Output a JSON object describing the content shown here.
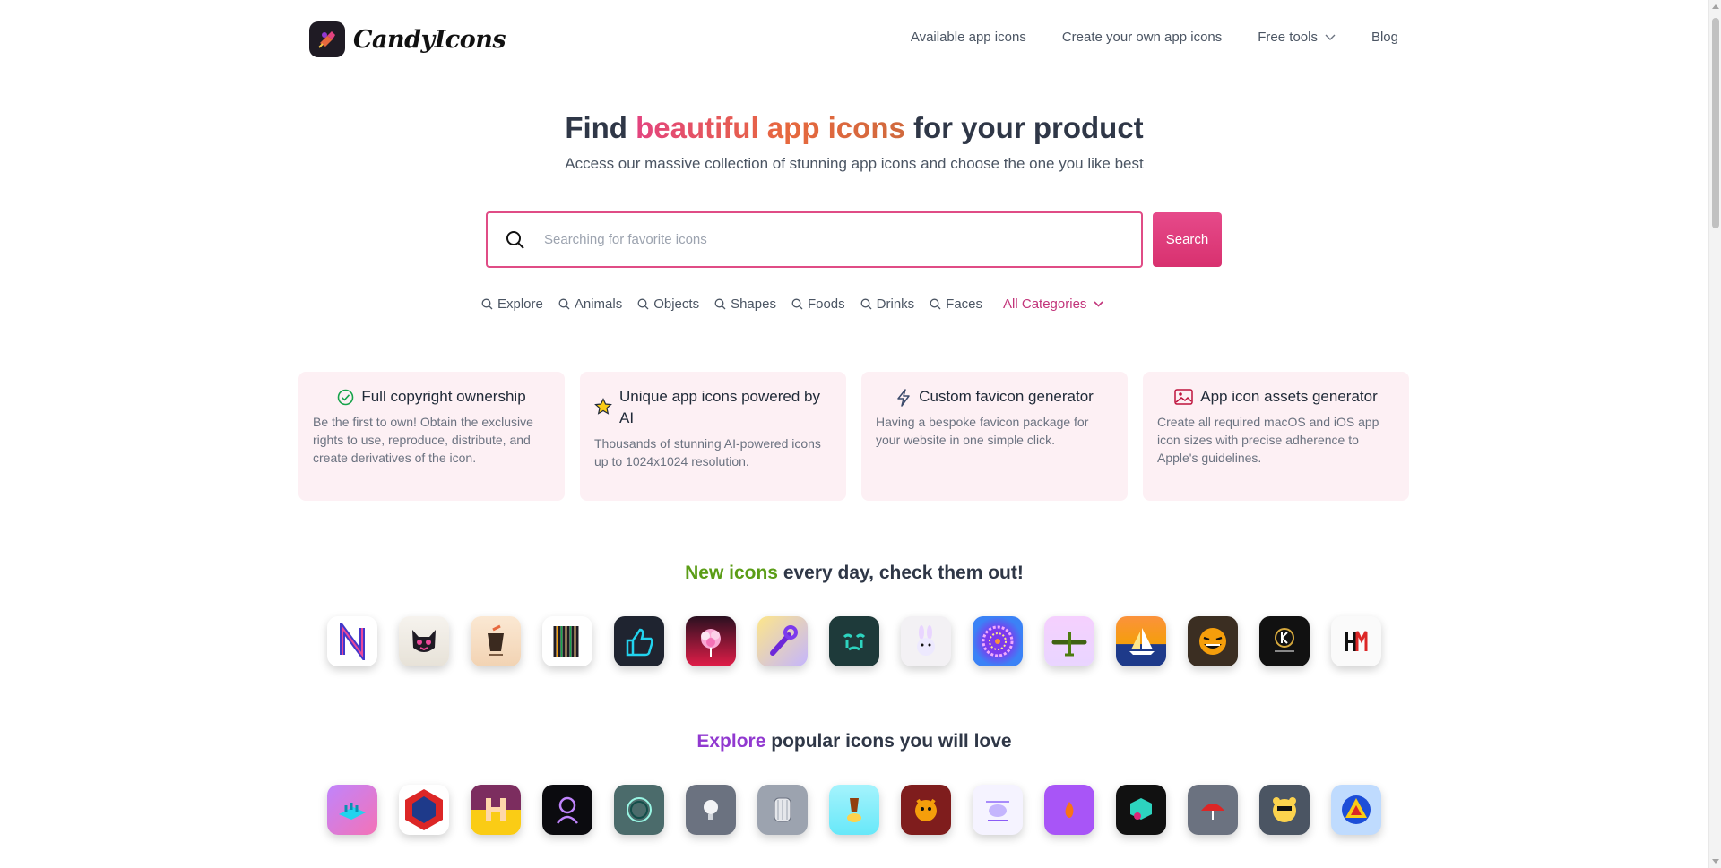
{
  "brand": {
    "name": "CandyIcons"
  },
  "nav": {
    "available": "Available app icons",
    "create": "Create your own app icons",
    "free_tools": "Free tools",
    "blog": "Blog"
  },
  "hero": {
    "title_pre": "Find ",
    "title_highlight": "beautiful app icons",
    "title_post": " for your product",
    "subtitle": "Access our massive collection of stunning app icons and choose the one you like best"
  },
  "search": {
    "placeholder": "Searching for favorite icons",
    "button": "Search"
  },
  "categories": {
    "items": [
      "Explore",
      "Animals",
      "Objects",
      "Shapes",
      "Foods",
      "Drinks",
      "Faces"
    ],
    "all": "All Categories"
  },
  "features": [
    {
      "icon": "check-circle-icon",
      "title": "Full copyright ownership",
      "body": "Be the first to own! Obtain the exclusive rights to use, reproduce, distribute, and create derivatives of the icon."
    },
    {
      "icon": "star-icon",
      "title": "Unique app icons powered by AI",
      "body": "Thousands of stunning AI-powered icons up to 1024x1024 resolution."
    },
    {
      "icon": "lightning-icon",
      "title": "Custom favicon generator",
      "body": "Having a bespoke favicon package for your website in one simple click."
    },
    {
      "icon": "image-icon",
      "title": "App icon assets generator",
      "body": "Create all required macOS and iOS app icon sizes with precise adherence to Apple's guidelines."
    }
  ],
  "new_section": {
    "highlight": "New icons",
    "rest": " every day, check them out!"
  },
  "explore_section": {
    "highlight": "Explore",
    "rest": " popular icons you will love"
  },
  "colors": {
    "accent_pink": "#e04c86",
    "feature_bg": "#fdf0f4",
    "green": "#5b9d17",
    "purple": "#9139d0"
  }
}
